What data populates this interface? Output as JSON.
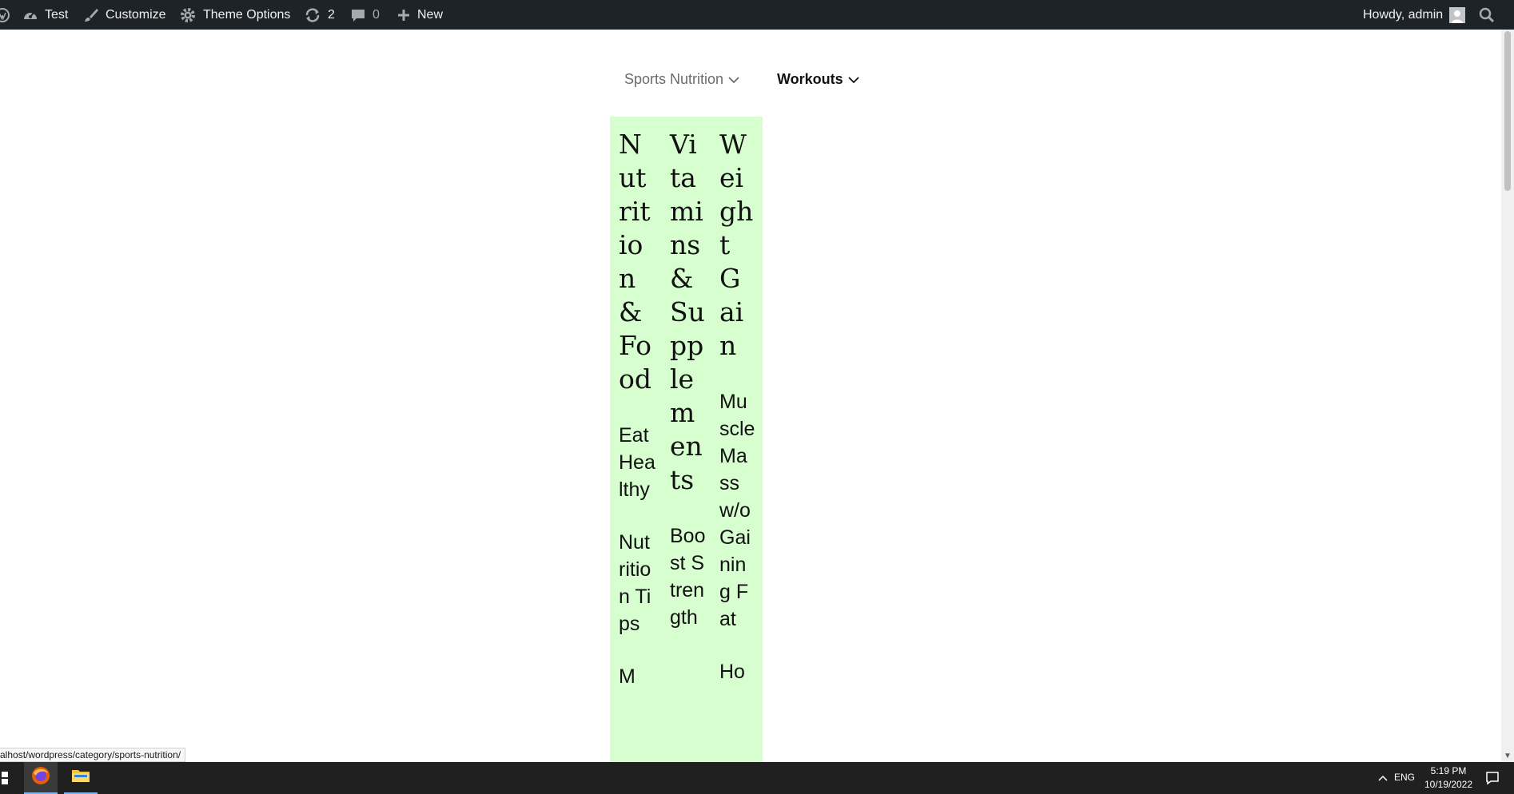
{
  "admin_bar": {
    "site_name": "Test",
    "customize": "Customize",
    "theme_options": "Theme Options",
    "updates_count": "2",
    "comments_count": "0",
    "new": "New",
    "howdy": "Howdy, admin"
  },
  "nav": {
    "items": [
      {
        "label": "Sports Nutrition"
      },
      {
        "label": "Workouts"
      }
    ]
  },
  "mega_menu": {
    "columns": [
      {
        "heading": "Nutrition & Food",
        "links": [
          "Eat Healthy",
          "Nutrition Tips",
          "M"
        ]
      },
      {
        "heading": "Vitamins & Supplements",
        "links": [
          "Boost Strength"
        ]
      },
      {
        "heading": "Weight Gain",
        "links": [
          "Muscle Mass w/o Gaining Fat",
          "Ho"
        ]
      }
    ]
  },
  "status_bar": {
    "url": "alhost/wordpress/category/sports-nutrition/"
  },
  "taskbar": {
    "language": "ENG",
    "time": "5:19 PM",
    "date": "10/19/2022"
  },
  "colors": {
    "admin_bar_bg": "#1d2327",
    "mega_menu_bg": "#d6fecf",
    "taskbar_bg": "#202020"
  }
}
